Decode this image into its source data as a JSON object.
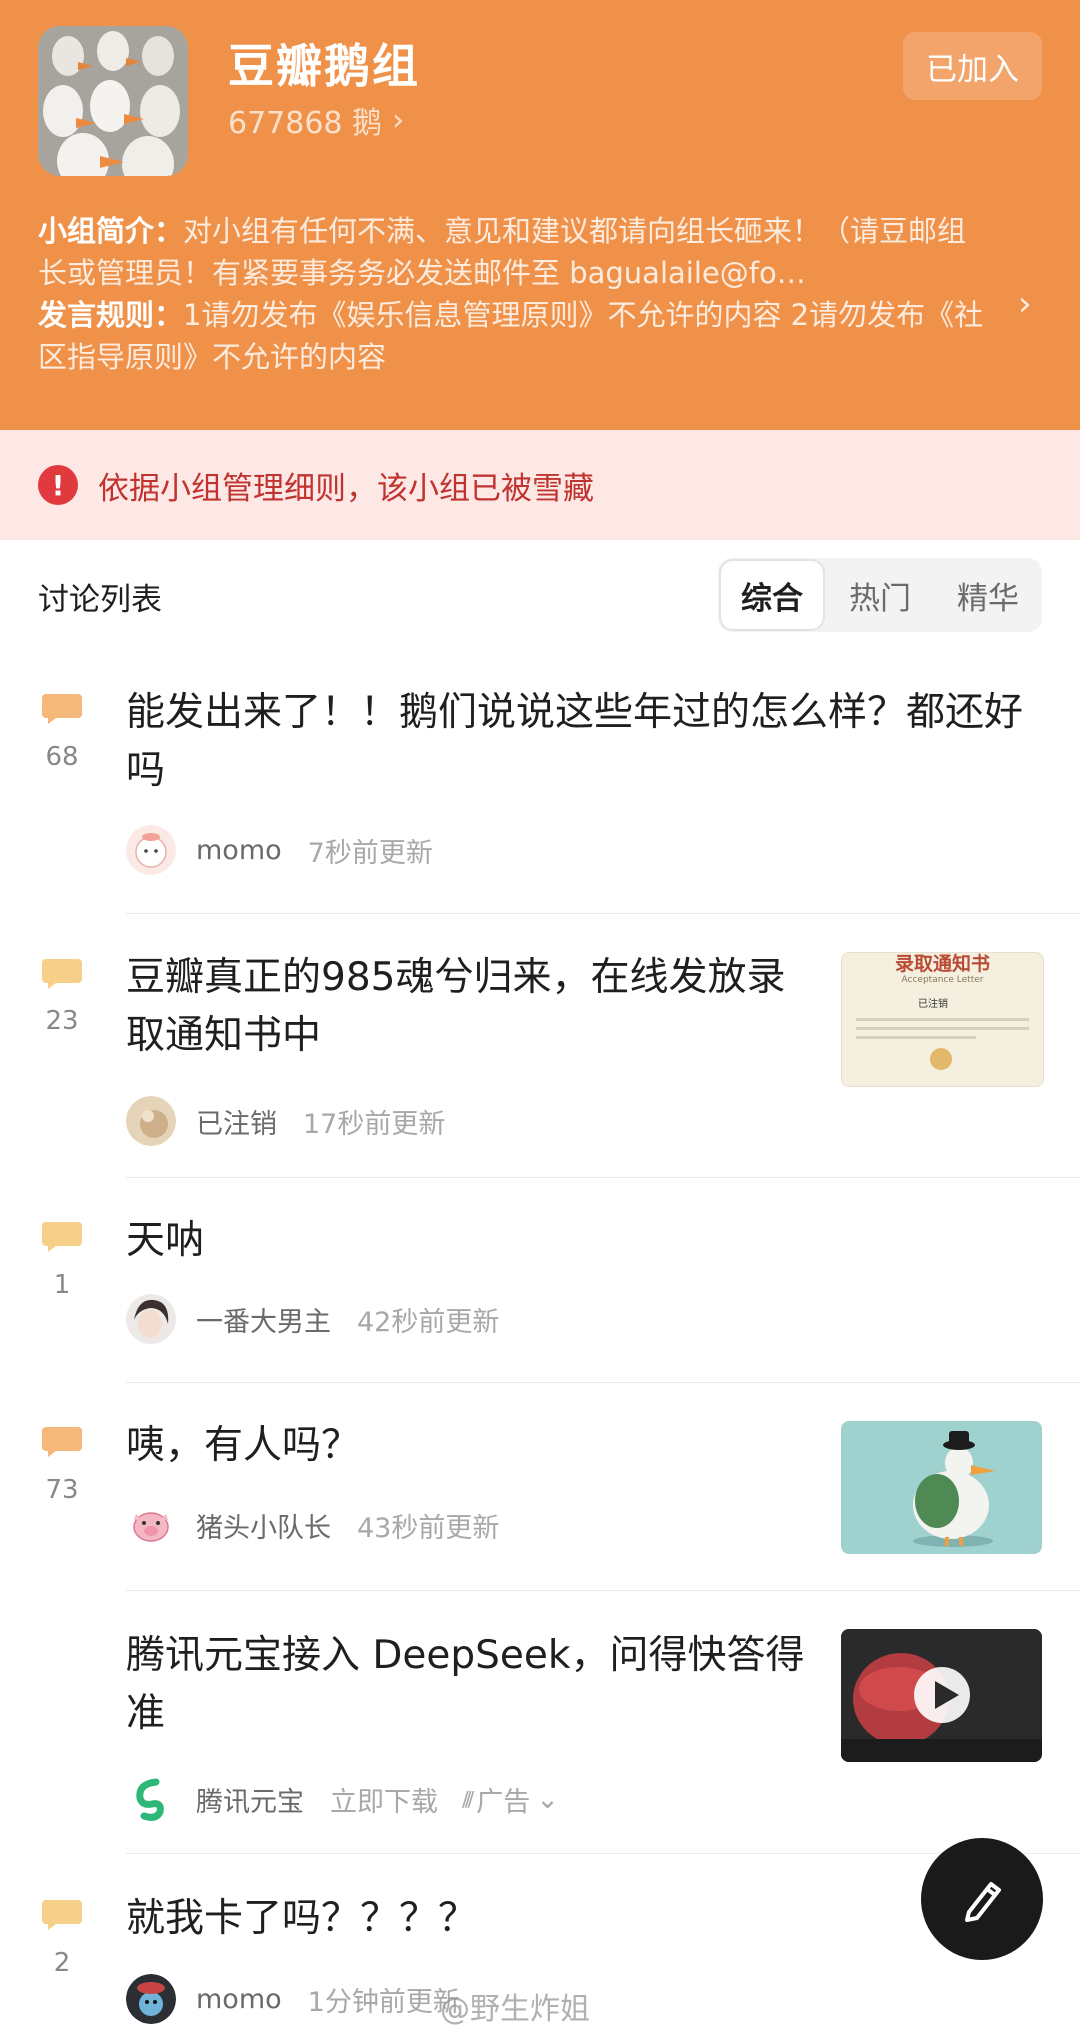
{
  "group": {
    "name": "豆瓣鹅组",
    "member_count": "677868 鹅",
    "joined_label": "已加入",
    "intro_label": "小组简介：",
    "intro_text": "对小组有任何不满、意见和建议都请向组长砸来！（请豆邮组长或管理员！有紧要事务务必发送邮件至 bagualaile@fo…",
    "rules_label": "发言规则：",
    "rules_text": "1请勿发布《娱乐信息管理原则》不允许的内容 2请勿发布《社区指导原则》不允许的内容"
  },
  "notice": {
    "text": "依据小组管理细则，该小组已被雪藏",
    "icon": "alert-circle-icon"
  },
  "list": {
    "title": "讨论列表",
    "tabs": [
      {
        "label": "综合"
      },
      {
        "label": "热门"
      },
      {
        "label": "精华"
      }
    ]
  },
  "posts": [
    {
      "count": "68",
      "title": "能发出来了！！鹅们说说这些年过的怎么样？都还好吗",
      "author": "momo",
      "time": "7秒前更新"
    },
    {
      "count": "23",
      "title": "豆瓣真正的985魂兮归来，在线发放录取通知书中",
      "author": "已注销",
      "time": "17秒前更新",
      "thumb_title": "录取通知书",
      "thumb_sub": "Acceptance Letter",
      "thumb_name": "已注销"
    },
    {
      "count": "1",
      "title": "天呐",
      "author": "一番大男主",
      "time": "42秒前更新"
    },
    {
      "count": "73",
      "title": "咦，有人吗？",
      "author": "猪头小队长",
      "time": "43秒前更新"
    },
    {
      "count": "2",
      "title": "就我卡了吗？？？？",
      "author": "momo",
      "time": "1分钟前更新"
    }
  ],
  "ad": {
    "title": "腾讯元宝接入 DeepSeek，问得快答得准",
    "advertiser": "腾讯元宝",
    "cta": "立即下载",
    "tag": "广告"
  },
  "watermark": "@野生炸姐",
  "colors": {
    "header": "#f0914a",
    "notice_bg": "#fde8e6",
    "notice_text": "#c0332f",
    "comment_icon": "#f6d089"
  }
}
